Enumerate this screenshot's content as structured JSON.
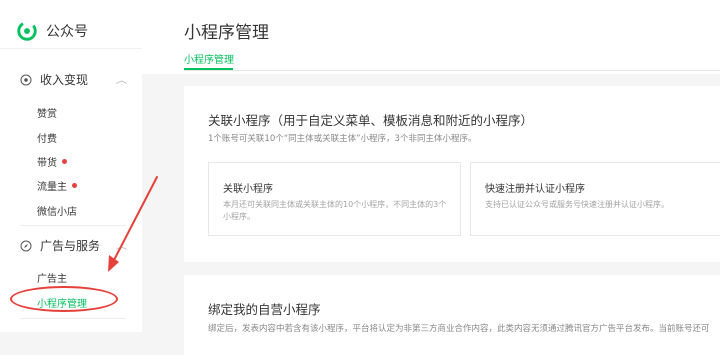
{
  "sidebar": {
    "logo_text": "公众号",
    "groups": [
      {
        "label": "收入变现",
        "items": [
          {
            "label": "赞赏"
          },
          {
            "label": "付费"
          },
          {
            "label": "带货"
          },
          {
            "label": "流量主"
          },
          {
            "label": "微信小店"
          }
        ]
      },
      {
        "label": "广告与服务",
        "items": [
          {
            "label": "广告主"
          },
          {
            "label": "小程序管理"
          }
        ]
      }
    ]
  },
  "main": {
    "page_title": "小程序管理",
    "tabs": [
      {
        "label": "小程序管理"
      }
    ],
    "card_link": {
      "title": "关联小程序（用于自定义菜单、模板消息和附近的小程序）",
      "desc": "1个账号可关联10个“同主体或关联主体”小程序，3个非同主体小程序。",
      "options": [
        {
          "title": "关联小程序",
          "desc": "本月还可关联同主体或关联主体的10个小程序，不同主体的3个小程序。"
        },
        {
          "title": "快速注册并认证小程序",
          "desc": "支持已认证公众号或服务号快速注册并认证小程序。"
        }
      ]
    },
    "card_own": {
      "title": "绑定我的自营小程序",
      "desc": "绑定后，发表内容中若含有该小程序，平台将认定为非第三方商业合作内容，此类内容无须通过腾讯官方广告平台发布。当前账号还可"
    }
  },
  "colors": {
    "brand_green": "#07c160",
    "red_dot": "#e64340",
    "annotation_red": "#e6403a"
  }
}
